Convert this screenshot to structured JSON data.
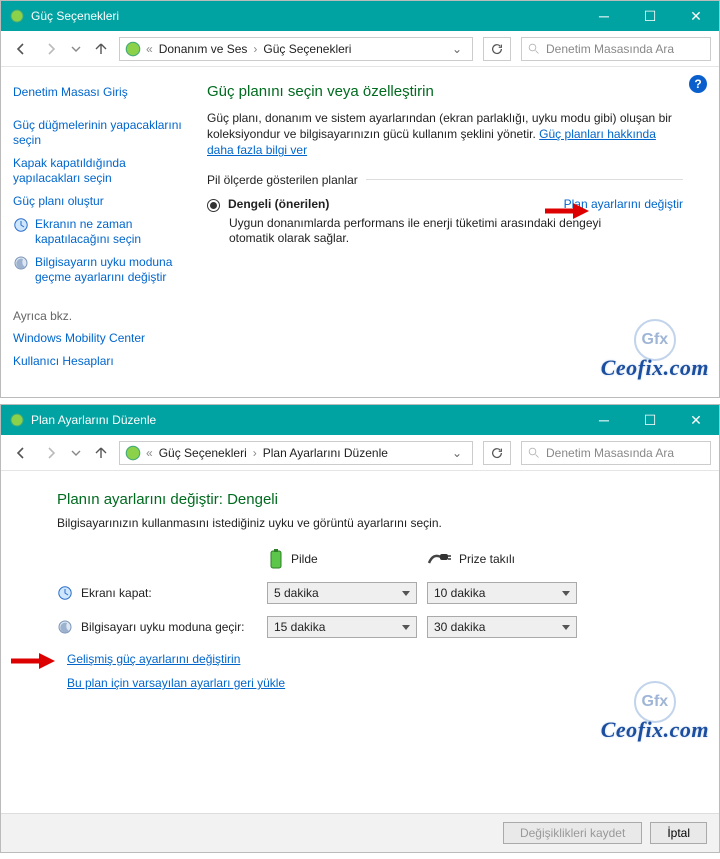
{
  "win1": {
    "title": "Güç Seçenekleri",
    "breadcrumbs": [
      "Donanım ve Ses",
      "Güç Seçenekleri"
    ],
    "search_placeholder": "Denetim Masasında Ara",
    "nav": {
      "home": "Denetim Masası Giriş",
      "buttons": "Güç düğmelerinin yapacaklarını seçin",
      "lid": "Kapak kapatıldığında yapılacakları seçin",
      "create": "Güç planı oluştur",
      "display_off": "Ekranın ne zaman kapatılacağını seçin",
      "sleep": "Bilgisayarın uyku moduna geçme ayarlarını değiştir",
      "see_also": "Ayrıca bkz.",
      "mobility": "Windows Mobility Center",
      "accounts": "Kullanıcı Hesapları"
    },
    "main": {
      "heading": "Güç planını seçin veya özelleştirin",
      "desc": "Güç planı, donanım ve sistem ayarlarından (ekran parlaklığı, uyku modu gibi) oluşan bir koleksiyondur ve bilgisayarınızın gücü kullanım şeklini yönetir. ",
      "more_link": "Güç planları hakkında daha fazla bilgi ver",
      "plans_label": "Pil ölçerde gösterilen planlar",
      "plan_name": "Dengeli (önerilen)",
      "plan_edit": "Plan ayarlarını değiştir",
      "plan_sub": "Uygun donanımlarda performans ile enerji tüketimi arasındaki dengeyi otomatik olarak sağlar."
    }
  },
  "win2": {
    "title": "Plan Ayarlarını Düzenle",
    "breadcrumbs": [
      "Güç Seçenekleri",
      "Plan Ayarlarını Düzenle"
    ],
    "search_placeholder": "Denetim Masasında Ara",
    "heading": "Planın ayarlarını değiştir: Dengeli",
    "sub": "Bilgisayarınızın kullanmasını istediğiniz uyku ve görüntü ayarlarını seçin.",
    "col_battery": "Pilde",
    "col_plugged": "Prize takılı",
    "row_display": "Ekranı kapat:",
    "row_sleep": "Bilgisayarı uyku moduna geçir:",
    "vals": {
      "display_battery": "5 dakika",
      "display_plugged": "10 dakika",
      "sleep_battery": "15 dakika",
      "sleep_plugged": "30 dakika"
    },
    "link_advanced": "Gelişmiş güç ayarlarını değiştirin",
    "link_restore": "Bu plan için varsayılan ayarları geri yükle",
    "btn_save": "Değişiklikleri kaydet",
    "btn_cancel": "İptal"
  },
  "watermark": "Ceofix.com",
  "watermark_badge": "Gfx"
}
